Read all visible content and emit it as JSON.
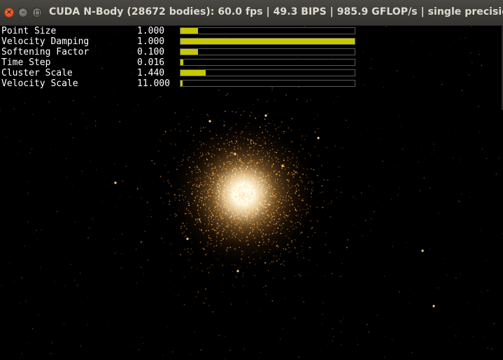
{
  "window": {
    "title": "CUDA N-Body (28672 bodies): 60.0 fps | 49.3 BIPS | 985.9 GFLOP/s | single precision",
    "controls": {
      "close": "×",
      "minimize": "–"
    }
  },
  "params": [
    {
      "label": "Point Size",
      "value": "1.000",
      "fill_fraction": 0.1
    },
    {
      "label": "Velocity Damping",
      "value": "1.000",
      "fill_fraction": 1.0
    },
    {
      "label": "Softening Factor",
      "value": "0.100",
      "fill_fraction": 0.1
    },
    {
      "label": "Time Step",
      "value": "0.016",
      "fill_fraction": 0.016
    },
    {
      "label": "Cluster Scale",
      "value": "1.440",
      "fill_fraction": 0.144
    },
    {
      "label": "Velocity Scale",
      "value": "11.000",
      "fill_fraction": 0.011
    }
  ],
  "colors": {
    "slider_fill": "#c8c800",
    "particle_core": "#ffffff",
    "particle_glow": "#ffb347",
    "background": "#000000"
  },
  "icons": {
    "close": "close-icon",
    "minimize": "minimize-icon",
    "maximize": "maximize-icon"
  }
}
